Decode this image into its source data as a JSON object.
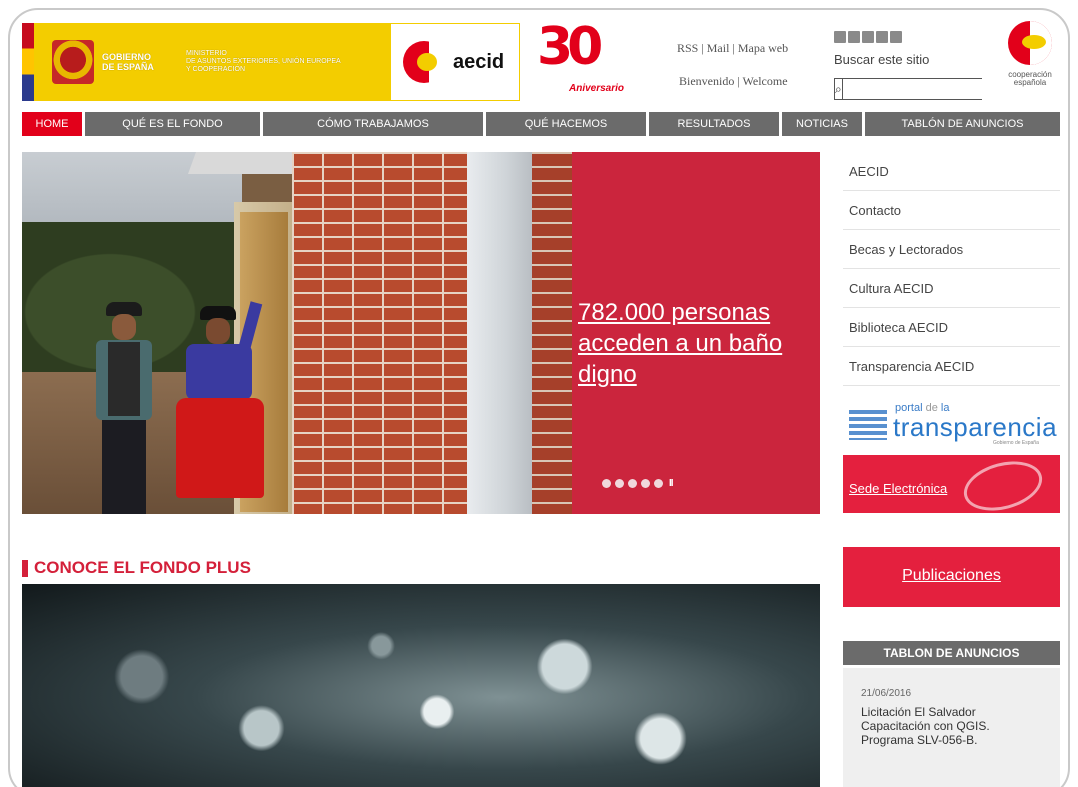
{
  "header": {
    "gov_line1": "GOBIERNO",
    "gov_line2": "DE ESPAÑA",
    "ministry_line1": "MINISTERIO",
    "ministry_line2": "DE ASUNTOS EXTERIORES, UNIÓN EUROPEA",
    "ministry_line3": "Y COOPERACIÓN",
    "aecid_label": "aecid",
    "anniversary_number": "30",
    "anniversary_label": "Aniversario",
    "links_row1": "RSS | Mail | Mapa web",
    "links_row2": "Bienvenido | Welcome",
    "search_label": "Buscar este sitio",
    "search_value": "",
    "search_placeholder": "",
    "coop_line1": "cooperación",
    "coop_line2": "española"
  },
  "nav": {
    "items": [
      {
        "label": "HOME"
      },
      {
        "label": "QUÉ ES EL FONDO"
      },
      {
        "label": "CÓMO TRABAJAMOS"
      },
      {
        "label": "QUÉ HACEMOS"
      },
      {
        "label": "RESULTADOS"
      },
      {
        "label": "NOTICIAS"
      },
      {
        "label": "TABLÓN DE ANUNCIOS"
      }
    ],
    "active_index": 0,
    "colors": {
      "active": "#e2001a",
      "inactive": "#6b6b6b"
    }
  },
  "slider": {
    "title": "782.000 personas acceden a un baño digno",
    "dots": 5,
    "active_dot": 0,
    "pause_glyph": "II",
    "panel_color": "#d61e3c"
  },
  "sidebar": {
    "links": [
      {
        "label": "AECID"
      },
      {
        "label": "Contacto"
      },
      {
        "label": "Becas y Lectorados"
      },
      {
        "label": "Cultura AECID"
      },
      {
        "label": "Biblioteca AECID"
      },
      {
        "label": "Transparencia AECID"
      }
    ],
    "portal_small": "portal",
    "portal_de": "de",
    "portal_la": "la",
    "portal_big": "transparencia",
    "portal_sub": "Gobierno de España",
    "sede_label": "Sede Electrónica",
    "pub_label": "Publicaciones",
    "tablon_title": "TABLON DE ANUNCIOS",
    "tablon_date": "21/06/2016",
    "tablon_text": "Licitación El Salvador Capacitación con QGIS. Programa SLV-056-B."
  },
  "section": {
    "title": "CONOCE EL FONDO PLUS"
  },
  "icons": {
    "search": "search-icon",
    "social": [
      "youtube-icon",
      "flickr-icon",
      "facebook-icon",
      "twitter-icon",
      "instagram-icon"
    ]
  }
}
